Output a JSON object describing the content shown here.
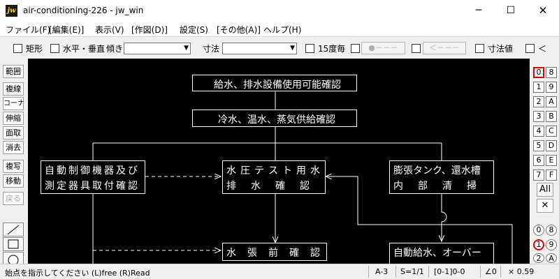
{
  "window": {
    "title": "air-conditioning-226 - jw_win",
    "app_icon_text": "jw",
    "min_glyph": "─",
    "max_glyph": "☐",
    "close_glyph": "✕"
  },
  "menu": [
    "ファイル(F)",
    "[編集(E)]",
    "表示(V)",
    "[作図(D)]",
    "設定(S)",
    "[その他(A)]",
    "ヘルプ(H)"
  ],
  "toolbar": {
    "rect_label": "矩形",
    "hv_label": "水平・垂直",
    "tilt_label": "傾き",
    "tilt_value": "",
    "dim_label": "寸法",
    "dim_value": "",
    "deg15_label": "15度毎",
    "disabled_btn1": "●－－－",
    "disabled_btn2": "＜－－－",
    "dimval_label": "寸法値",
    "last_label": "＜",
    "dropdown_glyph": "▼"
  },
  "left_tools": [
    "範囲",
    "複線",
    "コーナー",
    "伸縮",
    "面取",
    "消去",
    "複写",
    "移動",
    "戻る"
  ],
  "left_shapes": [
    "line-tool",
    "rectangle-tool",
    "circle-tool"
  ],
  "diagram": {
    "nodes": [
      {
        "id": "n1",
        "lines": [
          "給水、排水設備使用可能確認"
        ]
      },
      {
        "id": "n2",
        "lines": [
          "冷水、温水、蒸気供給確認"
        ]
      },
      {
        "id": "n3",
        "lines": [
          "自動制御機器及び",
          "測定器具取付確認"
        ]
      },
      {
        "id": "n4",
        "lines": [
          "水圧テスト用水",
          "排水確認"
        ]
      },
      {
        "id": "n5",
        "lines": [
          "膨張タンク、還水槽",
          "内部清掃"
        ]
      },
      {
        "id": "n6",
        "lines": [
          "水張前確認"
        ]
      },
      {
        "id": "n7",
        "lines": [
          "自動給水、オーバー"
        ]
      }
    ]
  },
  "layers": {
    "top": [
      "0",
      "8",
      "1",
      "9",
      "2",
      "A",
      "3",
      "B",
      "4",
      "C",
      "5",
      "D",
      "6",
      "E",
      "7",
      "F"
    ],
    "all_label": "All",
    "x_label": "✕",
    "group": [
      "0",
      "8",
      "1",
      "9",
      "2",
      "A"
    ]
  },
  "status": {
    "message": "始点を指示してください (L)free (R)Read",
    "paper": "A-3",
    "scale": "S=1/1",
    "layer": "[0-1]0-0",
    "angle": "∠0",
    "zoom": "× 0.59"
  }
}
